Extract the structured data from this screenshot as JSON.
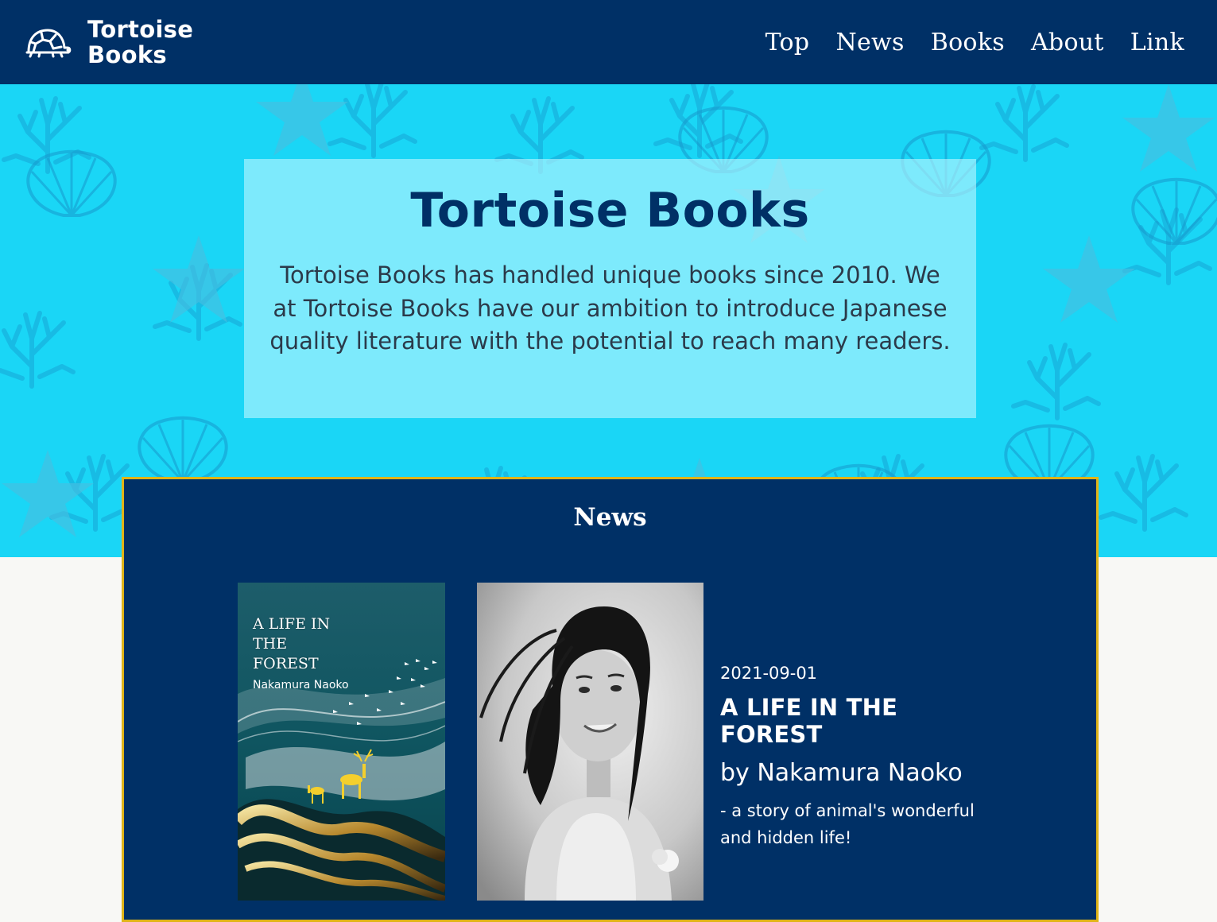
{
  "header": {
    "brand": "Tortoise Books",
    "nav": [
      "Top",
      "News",
      "Books",
      "About",
      "Link"
    ]
  },
  "hero": {
    "title": "Tortoise Books",
    "text": "Tortoise Books has handled unique books since 2010. We at Tortoise Books have our ambition to introduce Japanese quality literature with the potential to reach many readers."
  },
  "news": {
    "heading": "News",
    "cover": {
      "title": "A LIFE IN THE FOREST",
      "author": "Nakamura Naoko"
    },
    "item": {
      "date": "2021-09-01",
      "title": "A LIFE IN THE FOREST",
      "author": "by Nakamura Naoko",
      "description": "- a story of animal's wonderful and hidden life!"
    }
  },
  "colors": {
    "navy": "#003066",
    "aqua": "#1ad6f6",
    "gold": "#e0b417",
    "background": "#f8f8f5"
  },
  "icons": {
    "logo": "tortoise-icon"
  }
}
